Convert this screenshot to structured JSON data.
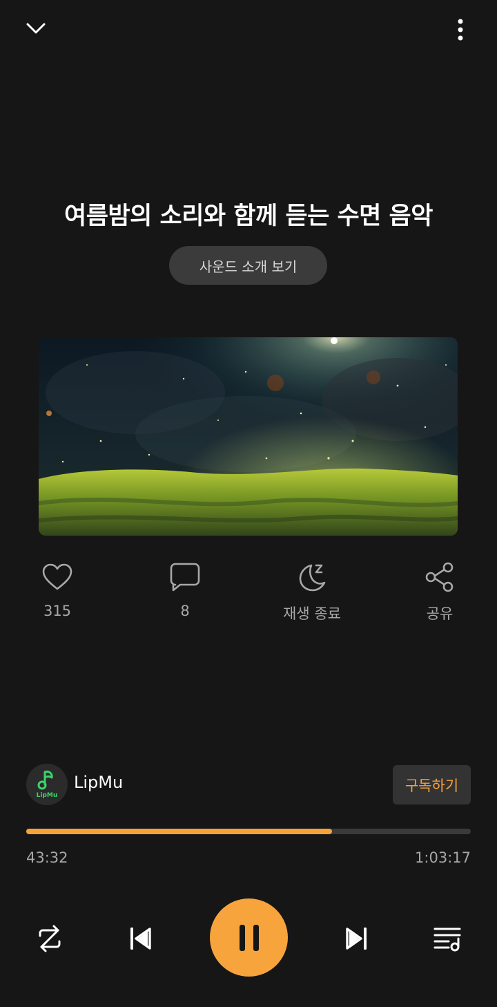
{
  "header": {
    "collapse_icon": "chevron-down-icon",
    "more_icon": "more-vertical-icon"
  },
  "track": {
    "title": "여름밤의 소리와 함께 듣는 수면 음악",
    "intro_button_label": "사운드 소개 보기",
    "cover_image": "night-meadow-fireflies"
  },
  "actions": {
    "like": {
      "icon": "heart-icon",
      "label": "315"
    },
    "comment": {
      "icon": "comment-icon",
      "label": "8"
    },
    "sleep_timer": {
      "icon": "moon-sleep-icon",
      "label": "재생 종료"
    },
    "share": {
      "icon": "share-icon",
      "label": "공유"
    }
  },
  "channel": {
    "name": "LipMu",
    "avatar_text": "LipMu",
    "subscribe_label": "구독하기"
  },
  "playback": {
    "current_time": "43:32",
    "total_time": "1:03:17",
    "progress_fraction": 0.688
  },
  "controls": {
    "repeat_icon": "repeat-icon",
    "previous_icon": "skip-previous-icon",
    "play_pause_icon": "pause-icon",
    "next_icon": "skip-next-icon",
    "queue_icon": "playlist-icon"
  },
  "colors": {
    "accent": "#f7a43c",
    "background": "#161616",
    "muted_text": "#a8a8a8"
  }
}
